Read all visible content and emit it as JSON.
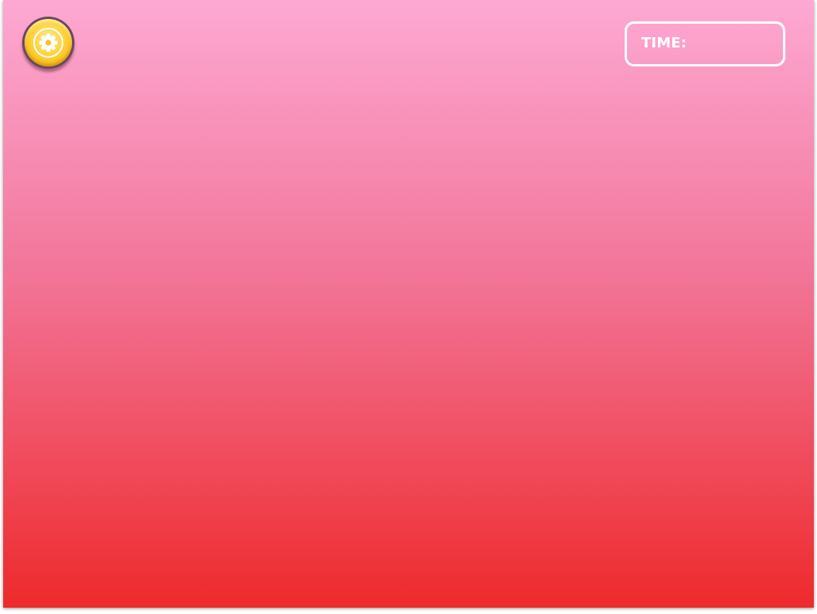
{
  "colors": {
    "background_top": "#fda9d3",
    "background_mid": "#f27599",
    "background_bottom": "#ee2a2c",
    "button_gold": "#ffd23a",
    "button_rim": "#6b4a5a",
    "timer_border": "#ffffff",
    "timer_text": "#ffffff"
  },
  "hud": {
    "settings_icon": "gear-icon",
    "timer_label": "TIME:",
    "timer_value": ""
  }
}
